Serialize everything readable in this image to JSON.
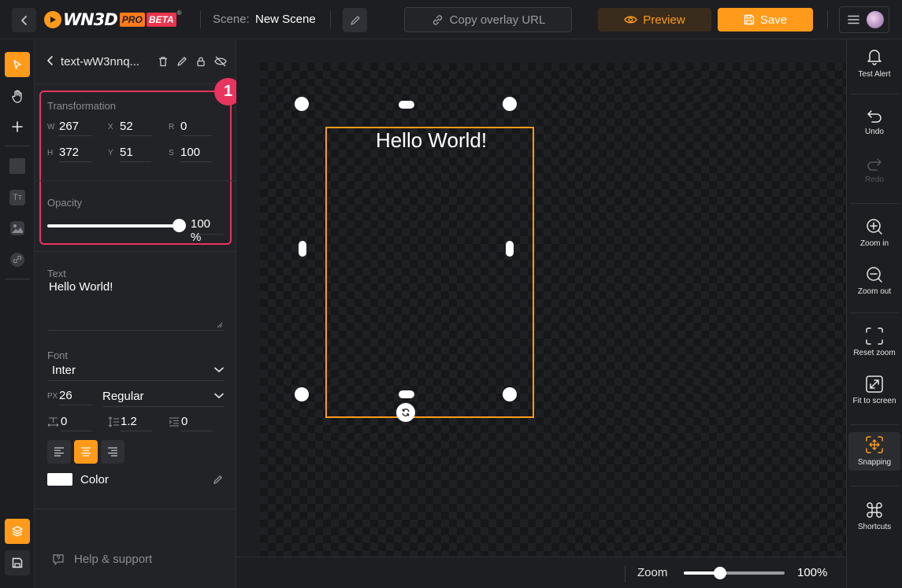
{
  "app": {
    "logo": {
      "word": "WN3D",
      "pro": "PRO",
      "beta": "BETA",
      "mark": "®"
    },
    "accent_color": "#ff9a1a",
    "highlight_color": "#e8345f"
  },
  "topbar": {
    "scene_label": "Scene:",
    "scene_name": "New Scene",
    "copy_url_label": "Copy overlay URL",
    "preview_label": "Preview",
    "save_label": "Save"
  },
  "panel": {
    "element_title": "text-wW3nnq...",
    "step_badge": "1",
    "transformation": {
      "label": "Transformation",
      "w_label": "W",
      "w": "267",
      "x_label": "X",
      "x": "52",
      "r_label": "R",
      "r": "0",
      "h_label": "H",
      "h": "372",
      "y_label": "Y",
      "y": "51",
      "s_label": "S",
      "s": "100"
    },
    "opacity": {
      "label": "Opacity",
      "value": "100 %",
      "fraction": 1.0
    },
    "text": {
      "label": "Text",
      "value": "Hello World!"
    },
    "font": {
      "label": "Font",
      "family": "Inter",
      "size_label": "PX",
      "size": "26",
      "weight": "Regular",
      "letter_spacing": "0",
      "line_height": "1.2",
      "indent": "0",
      "align_active": "center"
    },
    "color": {
      "label": "Color",
      "value": "#ffffff"
    },
    "help_label": "Help & support"
  },
  "canvas": {
    "text": "Hello World!"
  },
  "zoom": {
    "label": "Zoom",
    "value": "100%",
    "fraction": 0.36
  },
  "right_tools": [
    {
      "label": "Test Alert",
      "icon": "bell-icon",
      "enabled": true
    },
    {
      "label": "Undo",
      "icon": "undo-icon",
      "enabled": true
    },
    {
      "label": "Redo",
      "icon": "redo-icon",
      "enabled": false
    },
    {
      "label": "Zoom in",
      "icon": "zoom-in-icon",
      "enabled": true
    },
    {
      "label": "Zoom out",
      "icon": "zoom-out-icon",
      "enabled": true
    },
    {
      "label": "Reset zoom",
      "icon": "reset-zoom-icon",
      "enabled": true
    },
    {
      "label": "Fit to screen",
      "icon": "fit-screen-icon",
      "enabled": true
    },
    {
      "label": "Snapping",
      "icon": "snapping-icon",
      "enabled": true
    },
    {
      "label": "Shortcuts",
      "icon": "command-icon",
      "enabled": true
    }
  ]
}
